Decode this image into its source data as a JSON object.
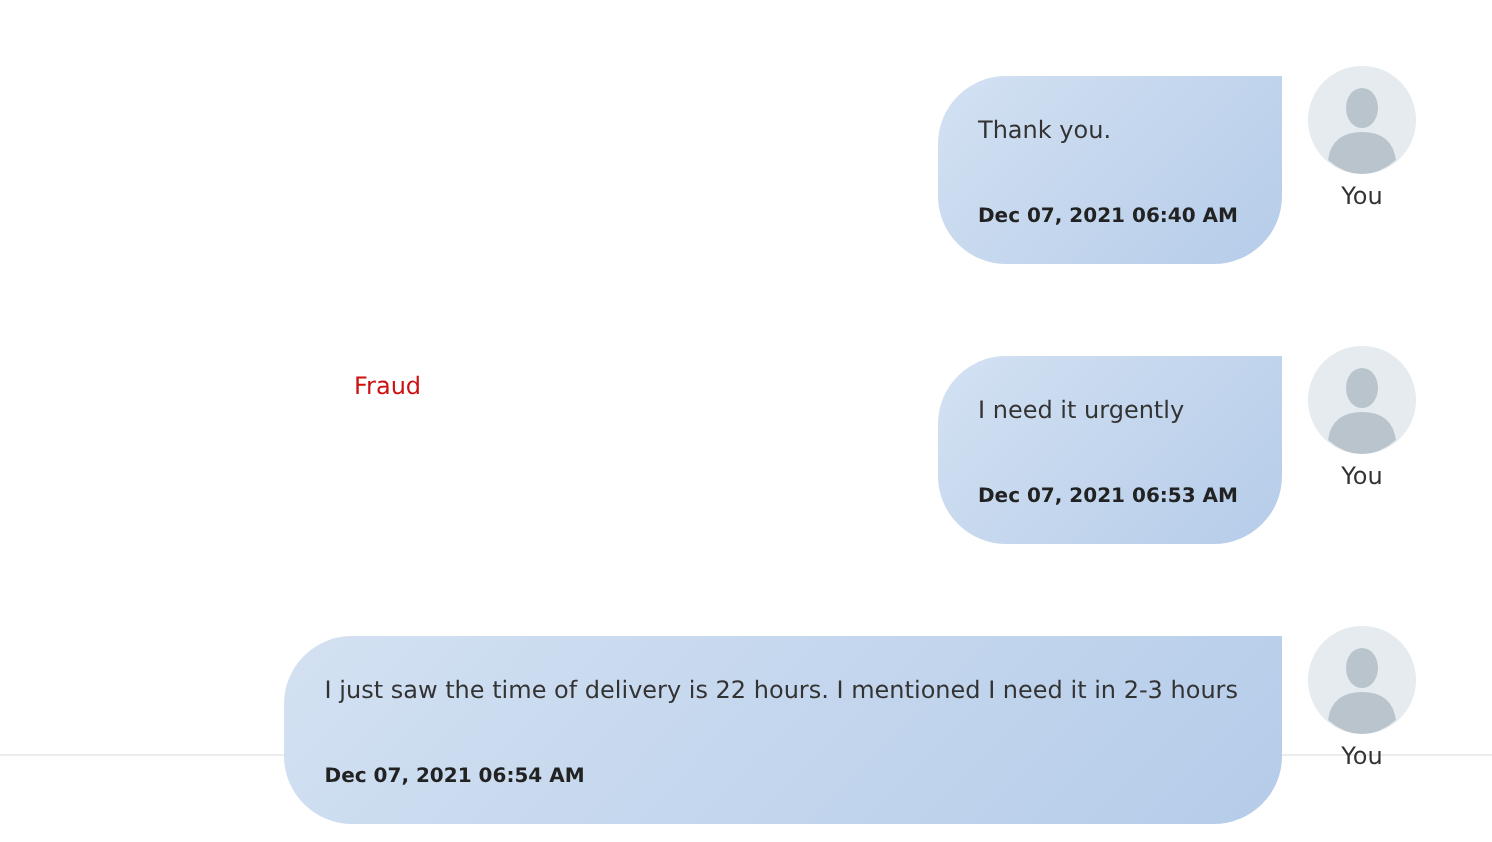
{
  "messages": [
    {
      "text": "Thank you.",
      "time": "Dec 07, 2021 06:40 AM",
      "author": "You"
    },
    {
      "text": "I need it urgently",
      "time": "Dec 07, 2021 06:53 AM",
      "author": "You",
      "note": "Fraud"
    },
    {
      "text": "I just saw the time of delivery is 22 hours. I mentioned I need it in 2-3 hours",
      "time": "Dec 07, 2021 06:54 AM",
      "author": "You"
    }
  ]
}
